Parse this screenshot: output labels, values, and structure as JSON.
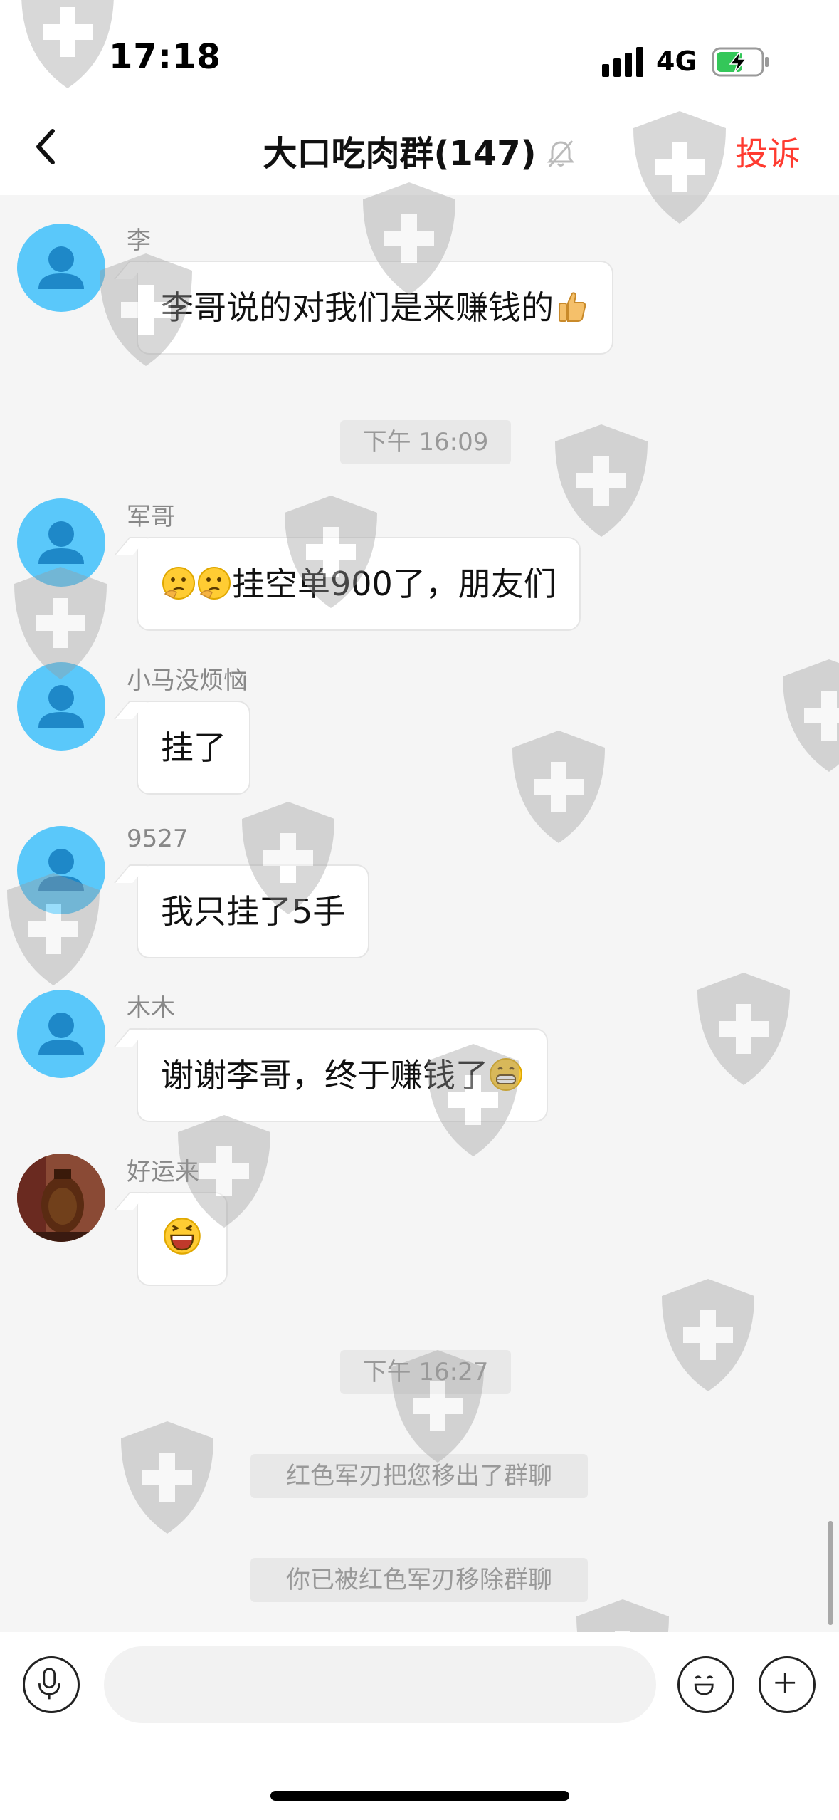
{
  "status_bar": {
    "time": "17:18",
    "network": "4G",
    "icons": [
      "signal-icon",
      "battery-charging-icon"
    ]
  },
  "header": {
    "title": "大口吃肉群(147)",
    "complain_label": "投诉",
    "icons": [
      "back-icon",
      "mute-bell-icon"
    ]
  },
  "messages": [
    {
      "sender": "李",
      "text": "李哥说的对我们是来赚钱的",
      "emoji_after": "thumbs-up"
    },
    {
      "type": "time",
      "text": "下午 16:09"
    },
    {
      "sender": "军哥",
      "emoji_before": "thinking-face x2",
      "text": "挂空单900了，朋友们"
    },
    {
      "sender": "小马没烦恼",
      "text": "挂了"
    },
    {
      "sender": "9527",
      "text": "我只挂了5手"
    },
    {
      "sender": "木木",
      "text": "谢谢李哥，终于赚钱了",
      "emoji_after": "grinning-face"
    },
    {
      "sender": "好运来",
      "emoji_only": "laughing-face"
    },
    {
      "type": "time",
      "text": "下午 16:27"
    },
    {
      "type": "system",
      "text": "红色军刃把您移出了群聊"
    },
    {
      "type": "system",
      "text": "你已被红色军刃移除群聊"
    }
  ],
  "input_bar": {
    "icons": [
      "microphone-icon",
      "emoji-icon",
      "plus-icon"
    ],
    "placeholder": ""
  },
  "colors": {
    "accent_red": "#ff3b30",
    "avatar_blue": "#5ac8fa",
    "background": "#f5f5f5"
  }
}
